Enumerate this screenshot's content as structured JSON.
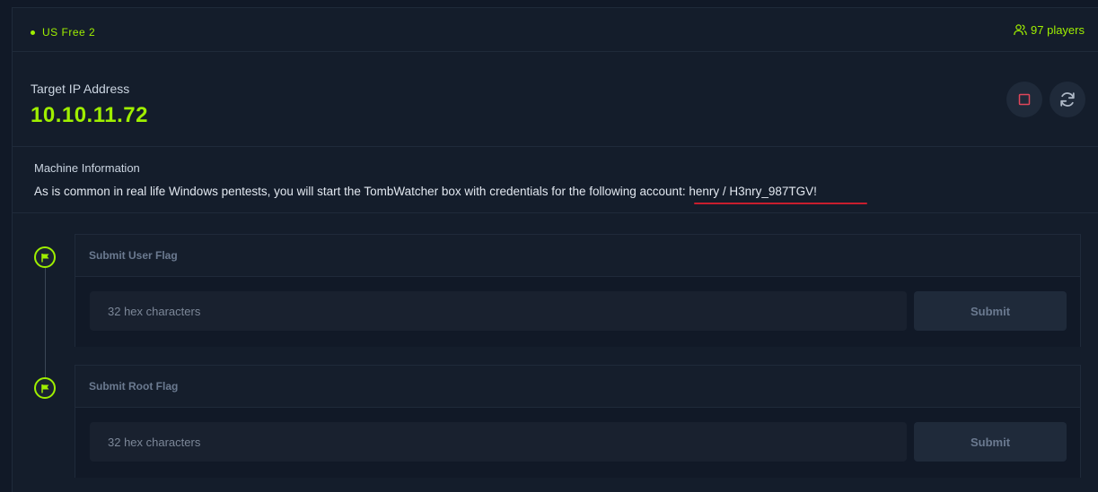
{
  "topbar": {
    "server_name": "US Free 2",
    "players": "97 players"
  },
  "target": {
    "label": "Target IP Address",
    "ip": "10.10.11.72"
  },
  "machine_info": {
    "title": "Machine Information",
    "description": "As is common in real life Windows pentests, you will start the TombWatcher box with credentials for the following account: henry / H3nry_987TGV!"
  },
  "flags": [
    {
      "title": "Submit User Flag",
      "placeholder": "32 hex characters",
      "submit_label": "Submit"
    },
    {
      "title": "Submit Root Flag",
      "placeholder": "32 hex characters",
      "submit_label": "Submit"
    }
  ],
  "colors": {
    "accent": "#9fef00",
    "background": "#141d2b",
    "stop": "#e0465a",
    "underline": "#c81e2e"
  }
}
